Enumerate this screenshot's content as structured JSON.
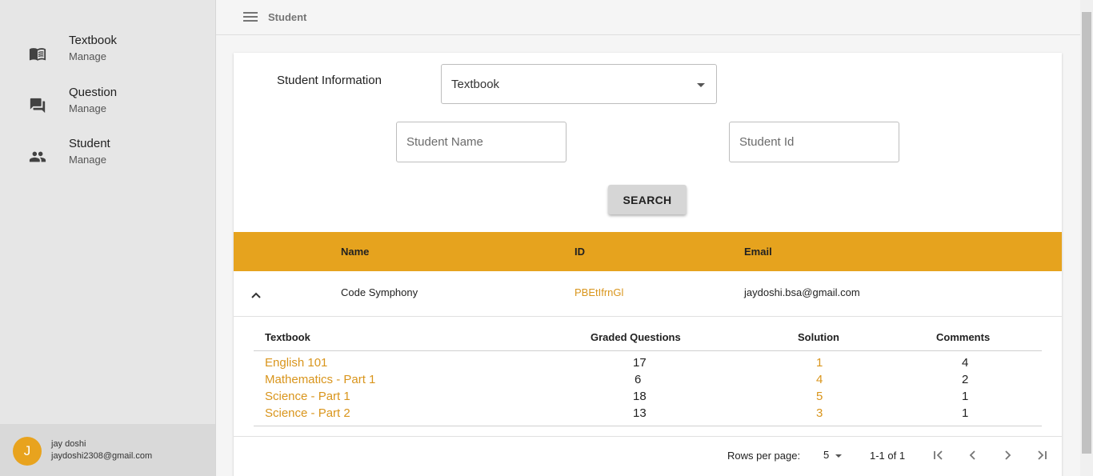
{
  "sidebar": {
    "items": [
      {
        "title": "Textbook",
        "subtitle": "Manage",
        "icon": "book-icon"
      },
      {
        "title": "Question",
        "subtitle": "Manage",
        "icon": "forum-icon"
      },
      {
        "title": "Student",
        "subtitle": "Manage",
        "icon": "people-icon"
      }
    ],
    "user": {
      "initial": "J",
      "name": "jay doshi",
      "email": "jaydoshi2308@gmail.com"
    }
  },
  "topbar": {
    "title": "Student"
  },
  "filters": {
    "label": "Student Information",
    "select_value": "Textbook",
    "name_placeholder": "Student Name",
    "id_placeholder": "Student Id",
    "search_label": "SEARCH"
  },
  "table": {
    "headers": {
      "name": "Name",
      "id": "ID",
      "email": "Email"
    },
    "row": {
      "name": "Code Symphony",
      "id": "PBEtIfrnGl",
      "email": "jaydoshi.bsa@gmail.com"
    }
  },
  "nested": {
    "headers": {
      "textbook": "Textbook",
      "graded": "Graded Questions",
      "solution": "Solution",
      "comments": "Comments"
    },
    "rows": [
      {
        "textbook": "English 101",
        "graded": "17",
        "solution": "1",
        "comments": "4"
      },
      {
        "textbook": "Mathematics - Part 1",
        "graded": "6",
        "solution": "4",
        "comments": "2"
      },
      {
        "textbook": "Science - Part 1",
        "graded": "18",
        "solution": "5",
        "comments": "1"
      },
      {
        "textbook": "Science - Part 2",
        "graded": "13",
        "solution": "3",
        "comments": "1"
      }
    ]
  },
  "pagination": {
    "rows_label": "Rows per page:",
    "rows_value": "5",
    "range": "1-1 of 1"
  },
  "colors": {
    "accent": "#e6a31e",
    "link": "#d9951c",
    "avatar": "#e8a31e"
  }
}
